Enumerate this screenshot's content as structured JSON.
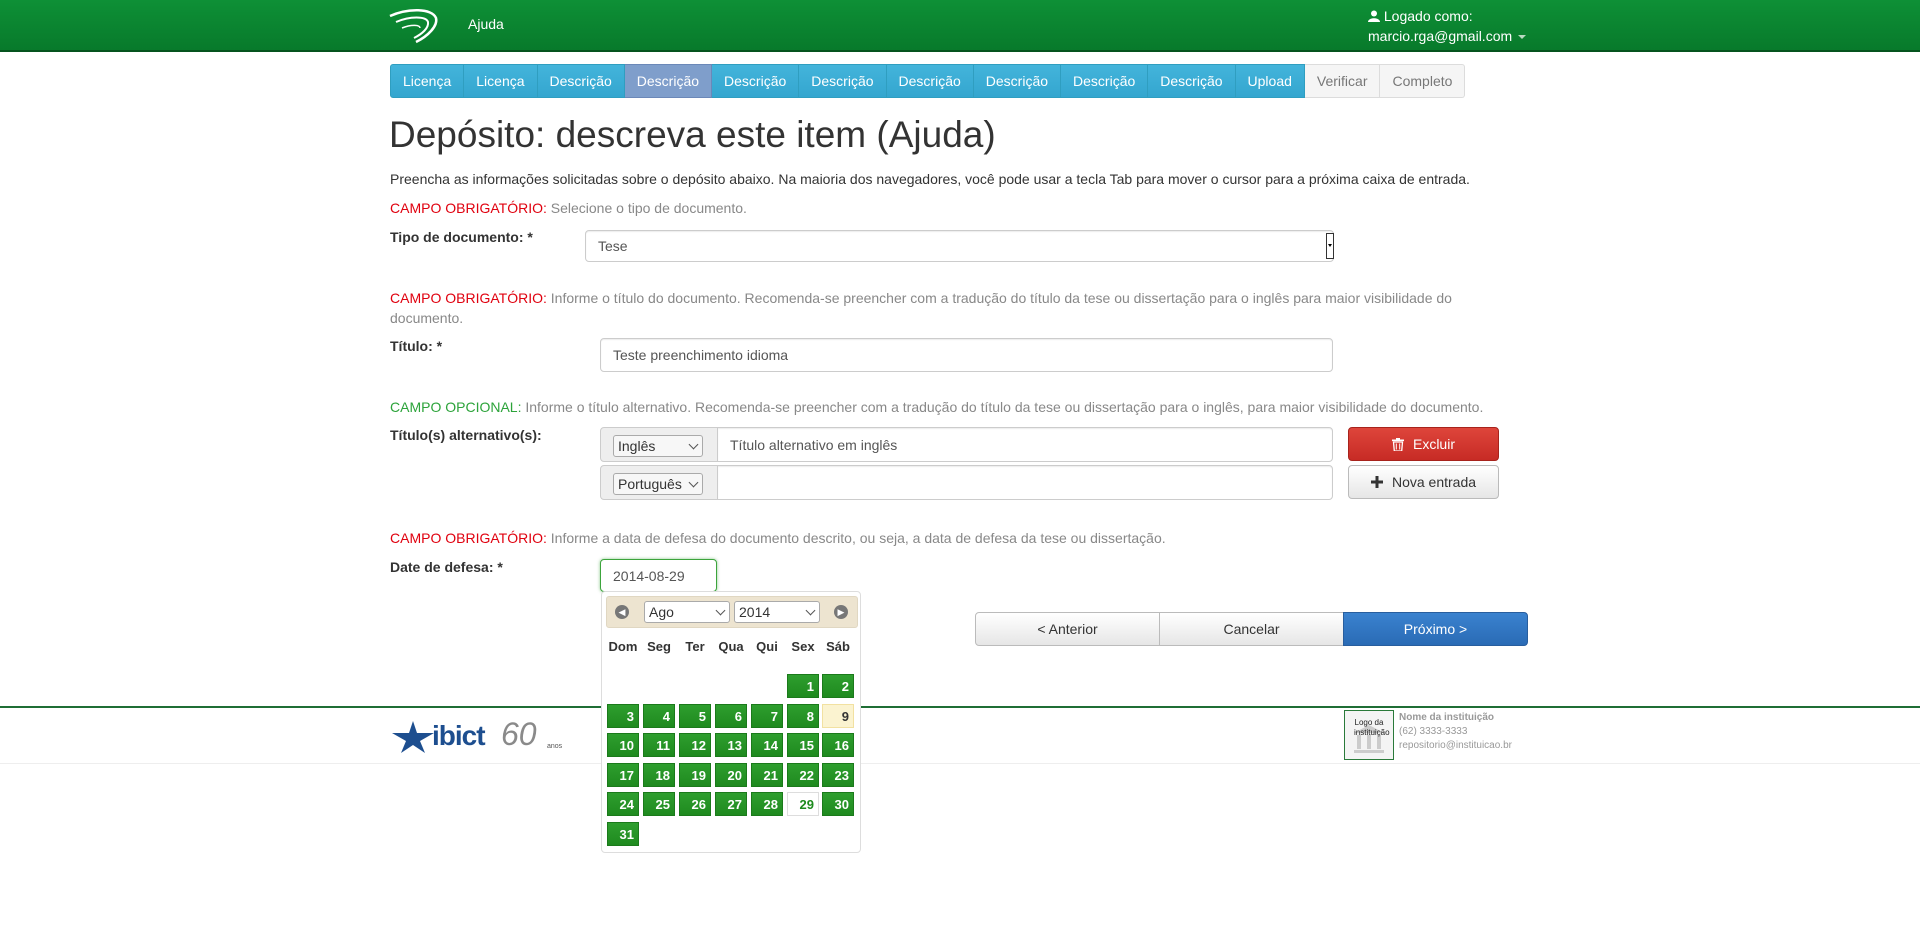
{
  "nav": {
    "help_label": "Ajuda",
    "user_label": "Logado como:",
    "user_email": "marcio.rga@gmail.com"
  },
  "progress_steps": [
    {
      "label": "Licença",
      "state": "done"
    },
    {
      "label": "Licença",
      "state": "done"
    },
    {
      "label": "Descrição",
      "state": "done"
    },
    {
      "label": "Descrição",
      "state": "current"
    },
    {
      "label": "Descrição",
      "state": "todo"
    },
    {
      "label": "Descrição",
      "state": "todo"
    },
    {
      "label": "Descrição",
      "state": "todo"
    },
    {
      "label": "Descrição",
      "state": "todo"
    },
    {
      "label": "Descrição",
      "state": "todo"
    },
    {
      "label": "Descrição",
      "state": "todo"
    },
    {
      "label": "Upload",
      "state": "todo"
    },
    {
      "label": "Verificar",
      "state": "future"
    },
    {
      "label": "Completo",
      "state": "future"
    }
  ],
  "page": {
    "title": "Depósito: descreva este item (Ajuda)",
    "intro": "Preencha as informações solicitadas sobre o depósito abaixo. Na maioria dos navegadores, você pode usar a tecla Tab para mover o cursor para a próxima caixa de entrada."
  },
  "fields": {
    "doctype": {
      "hint_tag": "CAMPO OBRIGATÓRIO:",
      "hint": " Selecione o tipo de documento.",
      "label": "Tipo de documento: *",
      "value": "Tese"
    },
    "title": {
      "hint_tag": "CAMPO OBRIGATÓRIO:",
      "hint": " Informe o título do documento. Recomenda-se preencher com a tradução do título da tese ou dissertação para o inglês para maior visibilidade do documento.",
      "label": "Título: *",
      "value": "Teste preenchimento idioma"
    },
    "alt_title": {
      "hint_tag": "CAMPO OPCIONAL:",
      "hint": " Informe o título alternativo. Recomenda-se preencher com a tradução do título da tese ou dissertação para o inglês, para maior visibilidade do documento.",
      "label": "Título(s) alternativo(s):",
      "row1_lang": "Inglês",
      "row1_value": "Título alternativo em inglês",
      "row2_lang": "Português",
      "row2_value": "",
      "delete_label": "Excluir",
      "add_label": "Nova entrada"
    },
    "defense_date": {
      "hint_tag": "CAMPO OBRIGATÓRIO:",
      "hint": " Informe a data de defesa do documento descrito, ou seja, a data de defesa da tese ou dissertação.",
      "label": "Date de defesa: *",
      "value": "2014-08-29"
    }
  },
  "buttons": {
    "prev": "< Anterior",
    "cancel": "Cancelar",
    "next": "Próximo >"
  },
  "datepicker": {
    "month": "Ago",
    "year": "2014",
    "weekdays": [
      "Dom",
      "Seg",
      "Ter",
      "Qua",
      "Qui",
      "Sex",
      "Sáb"
    ],
    "first_weekday_index": 5,
    "days_in_month": 31,
    "today": 9,
    "selected": 29
  },
  "footer": {
    "ibict_text": "ibict",
    "ibict_60": "60",
    "ibict_anos": "anos",
    "inst_logo_text": "Logo da instituição",
    "inst_name": "Nome da instituição",
    "inst_phone": "(62) 3333-3333",
    "inst_email": "repositorio@instituicao.br"
  },
  "colors": {
    "navbar": "#0e9036",
    "step_active": "#43b4db",
    "step_current": "#7f9ecb",
    "required": "#e0000e",
    "optional": "#2ca33a",
    "calendar_day": "#2e9e2e",
    "danger": "#d9382f",
    "primary": "#3276c5"
  }
}
